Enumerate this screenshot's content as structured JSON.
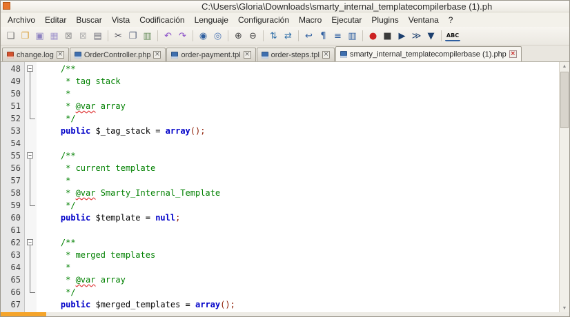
{
  "window": {
    "title": "C:\\Users\\Gloria\\Downloads\\smarty_internal_templatecompilerbase (1).ph"
  },
  "menu": {
    "items": [
      {
        "id": "archivo",
        "label": "Archivo"
      },
      {
        "id": "editar",
        "label": "Editar"
      },
      {
        "id": "buscar",
        "label": "Buscar"
      },
      {
        "id": "vista",
        "label": "Vista"
      },
      {
        "id": "codificacion",
        "label": "Codificación"
      },
      {
        "id": "lenguaje",
        "label": "Lenguaje"
      },
      {
        "id": "configuracion",
        "label": "Configuración"
      },
      {
        "id": "macro",
        "label": "Macro"
      },
      {
        "id": "ejecutar",
        "label": "Ejecutar"
      },
      {
        "id": "plugins",
        "label": "Plugins"
      },
      {
        "id": "ventana",
        "label": "Ventana"
      },
      {
        "id": "help",
        "label": "?"
      }
    ]
  },
  "toolbar": {
    "items": [
      {
        "name": "new-file-icon",
        "glyph": "❏",
        "color": "#6a6a6a"
      },
      {
        "name": "open-folder-icon",
        "glyph": "❒",
        "color": "#d79b2f"
      },
      {
        "name": "save-icon",
        "glyph": "▣",
        "color": "#8d82c0"
      },
      {
        "name": "save-all-icon",
        "glyph": "▦",
        "color": "#a79ccf"
      },
      {
        "name": "close-file-icon",
        "glyph": "⊠",
        "color": "#8a8a8a"
      },
      {
        "name": "close-all-icon",
        "glyph": "⊠",
        "color": "#b0b0b0"
      },
      {
        "name": "print-icon",
        "glyph": "▤",
        "color": "#6f6f7a"
      },
      {
        "type": "sep"
      },
      {
        "name": "cut-icon",
        "glyph": "✂",
        "color": "#4a4a55"
      },
      {
        "name": "copy-icon",
        "glyph": "❐",
        "color": "#55607a"
      },
      {
        "name": "paste-icon",
        "glyph": "▥",
        "color": "#6a8f5f"
      },
      {
        "type": "sep"
      },
      {
        "name": "undo-icon",
        "glyph": "↶",
        "color": "#8a4fc8"
      },
      {
        "name": "redo-icon",
        "glyph": "↷",
        "color": "#8a4fc8"
      },
      {
        "type": "sep"
      },
      {
        "name": "find-icon",
        "glyph": "◉",
        "color": "#2f5fa0"
      },
      {
        "name": "replace-icon",
        "glyph": "◎",
        "color": "#4a75b5"
      },
      {
        "type": "sep"
      },
      {
        "name": "zoom-in-icon",
        "glyph": "⊕",
        "color": "#4a4a4a"
      },
      {
        "name": "zoom-out-icon",
        "glyph": "⊖",
        "color": "#4a4a4a"
      },
      {
        "type": "sep"
      },
      {
        "name": "sync-vertical-icon",
        "glyph": "⇅",
        "color": "#2f6fa8"
      },
      {
        "name": "sync-horizontal-icon",
        "glyph": "⇄",
        "color": "#2f6fa8"
      },
      {
        "type": "sep"
      },
      {
        "name": "word-wrap-icon",
        "glyph": "↩",
        "color": "#2f5fa0"
      },
      {
        "name": "show-all-characters-icon",
        "glyph": "¶",
        "color": "#2f5fa0"
      },
      {
        "name": "indent-guide-icon",
        "glyph": "≡",
        "color": "#2f5fa0"
      },
      {
        "name": "document-map-icon",
        "glyph": "▥",
        "color": "#2f5fa0"
      },
      {
        "type": "sep"
      },
      {
        "name": "record-macro-icon",
        "glyph": "●",
        "color": "#cc2222"
      },
      {
        "name": "stop-macro-icon",
        "glyph": "■",
        "color": "#3a3a3a"
      },
      {
        "name": "play-macro-icon",
        "glyph": "▶",
        "color": "#1c3f6e"
      },
      {
        "name": "run-macro-multiple-icon",
        "glyph": "≫",
        "color": "#1c3f6e"
      },
      {
        "name": "save-macro-icon",
        "glyph": "▼",
        "color": "#1c3f6e"
      },
      {
        "type": "sep"
      },
      {
        "name": "spellcheck-abc-icon",
        "glyph": "ABC",
        "color": "#111111",
        "cls": "tb-abc"
      }
    ]
  },
  "tabs": [
    {
      "label": "change.log",
      "icon_color": "#d2522e",
      "active": false
    },
    {
      "label": "OrderController.php",
      "icon_color": "#3f6fae",
      "active": false
    },
    {
      "label": "order-payment.tpl",
      "icon_color": "#3f6fae",
      "active": false
    },
    {
      "label": "order-steps.tpl",
      "icon_color": "#3f6fae",
      "active": false
    },
    {
      "label": "smarty_internal_templatecompilerbase (1).php",
      "icon_color": "#3f6fae",
      "active": true
    }
  ],
  "editor": {
    "syntax_colors": {
      "comment": "#008000",
      "keyword": "#0000c8",
      "plain": "#000000",
      "punctuation": "#8b1a00",
      "underline": "#e03c3c"
    },
    "lines": [
      {
        "num": 48,
        "fold": "start",
        "segs": [
          [
            "    /**",
            "comment"
          ]
        ]
      },
      {
        "num": 49,
        "fold": "line",
        "segs": [
          [
            "     * tag stack",
            "comment"
          ]
        ]
      },
      {
        "num": 50,
        "fold": "line",
        "segs": [
          [
            "     *",
            "comment"
          ]
        ]
      },
      {
        "num": 51,
        "fold": "line",
        "segs": [
          [
            "     * ",
            "comment"
          ],
          [
            "@var",
            "commentw"
          ],
          [
            " array",
            "comment"
          ]
        ]
      },
      {
        "num": 52,
        "fold": "end",
        "segs": [
          [
            "     */",
            "comment"
          ]
        ]
      },
      {
        "num": 53,
        "fold": "none",
        "segs": [
          [
            "    ",
            "plain"
          ],
          [
            "public",
            "kw"
          ],
          [
            " $_tag_stack ",
            "plain"
          ],
          [
            "= ",
            "plain"
          ],
          [
            "array",
            "kw"
          ],
          [
            "();",
            "punct"
          ]
        ]
      },
      {
        "num": 54,
        "fold": "none",
        "segs": []
      },
      {
        "num": 55,
        "fold": "start",
        "segs": [
          [
            "    /**",
            "comment"
          ]
        ]
      },
      {
        "num": 56,
        "fold": "line",
        "segs": [
          [
            "     * current template",
            "comment"
          ]
        ]
      },
      {
        "num": 57,
        "fold": "line",
        "segs": [
          [
            "     *",
            "comment"
          ]
        ]
      },
      {
        "num": 58,
        "fold": "line",
        "segs": [
          [
            "     * ",
            "comment"
          ],
          [
            "@var",
            "commentw"
          ],
          [
            " Smarty_Internal_Template",
            "comment"
          ]
        ]
      },
      {
        "num": 59,
        "fold": "end",
        "segs": [
          [
            "     */",
            "comment"
          ]
        ]
      },
      {
        "num": 60,
        "fold": "none",
        "segs": [
          [
            "    ",
            "plain"
          ],
          [
            "public",
            "kw"
          ],
          [
            " $template ",
            "plain"
          ],
          [
            "= ",
            "plain"
          ],
          [
            "null",
            "kw"
          ],
          [
            ";",
            "punct"
          ]
        ]
      },
      {
        "num": 61,
        "fold": "none",
        "segs": []
      },
      {
        "num": 62,
        "fold": "start",
        "segs": [
          [
            "    /**",
            "comment"
          ]
        ]
      },
      {
        "num": 63,
        "fold": "line",
        "segs": [
          [
            "     * merged templates",
            "comment"
          ]
        ]
      },
      {
        "num": 64,
        "fold": "line",
        "segs": [
          [
            "     *",
            "comment"
          ]
        ]
      },
      {
        "num": 65,
        "fold": "line",
        "segs": [
          [
            "     * ",
            "comment"
          ],
          [
            "@var",
            "commentw"
          ],
          [
            " array",
            "comment"
          ]
        ]
      },
      {
        "num": 66,
        "fold": "end",
        "segs": [
          [
            "     */",
            "comment"
          ]
        ]
      },
      {
        "num": 67,
        "fold": "none",
        "segs": [
          [
            "    ",
            "plain"
          ],
          [
            "public",
            "kw"
          ],
          [
            " $merged_templates ",
            "plain"
          ],
          [
            "= ",
            "plain"
          ],
          [
            "array",
            "kw"
          ],
          [
            "();",
            "punct"
          ]
        ]
      }
    ]
  }
}
